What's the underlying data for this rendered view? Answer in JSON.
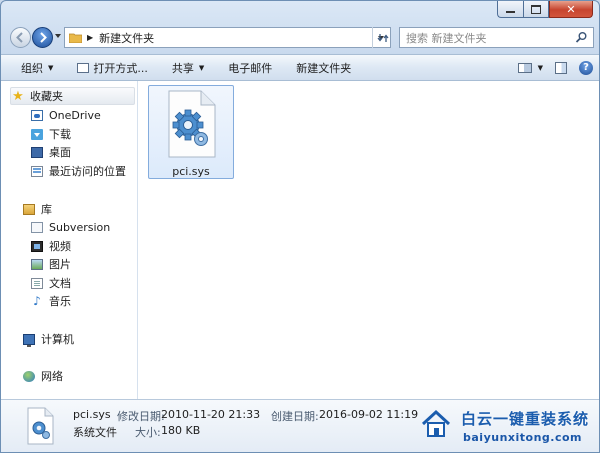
{
  "window": {
    "caption": {
      "minimize": "minimize",
      "maximize": "maximize",
      "close": "✕"
    }
  },
  "address_bar": {
    "path": "新建文件夹",
    "search_placeholder": "搜索 新建文件夹"
  },
  "toolbar": {
    "organize": "组织",
    "open_with": "打开方式...",
    "share": "共享",
    "email": "电子邮件",
    "new_folder": "新建文件夹"
  },
  "nav_pane": {
    "favorites": {
      "label": "收藏夹",
      "items": [
        {
          "label": "OneDrive",
          "icon": "onedrive-icon"
        },
        {
          "label": "下载",
          "icon": "downloads-icon"
        },
        {
          "label": "桌面",
          "icon": "desktop-icon"
        },
        {
          "label": "最近访问的位置",
          "icon": "recent-places-icon"
        }
      ]
    },
    "libraries": {
      "label": "库",
      "items": [
        {
          "label": "Subversion",
          "icon": "subversion-icon"
        },
        {
          "label": "视频",
          "icon": "videos-icon"
        },
        {
          "label": "图片",
          "icon": "pictures-icon"
        },
        {
          "label": "文档",
          "icon": "documents-icon"
        },
        {
          "label": "音乐",
          "icon": "music-icon"
        }
      ]
    },
    "computer": {
      "label": "计算机"
    },
    "network": {
      "label": "网络"
    }
  },
  "files": [
    {
      "name": "pci.sys",
      "icon": "system-file-gear-icon",
      "selected": true
    }
  ],
  "details": {
    "name": "pci.sys",
    "type": "系统文件",
    "modified_label": "修改日期:",
    "modified_value": "2010-11-20 21:33",
    "created_label": "创建日期:",
    "created_value": "2016-09-02 11:19",
    "size_label": "大小:",
    "size_value": "180 KB"
  },
  "watermark": {
    "title": "白云一键重装系统",
    "url": "baiyunxitong.com"
  },
  "colors": {
    "accent": "#1d4f9b",
    "selection": "#dceafb",
    "close_button": "#c7452f"
  }
}
